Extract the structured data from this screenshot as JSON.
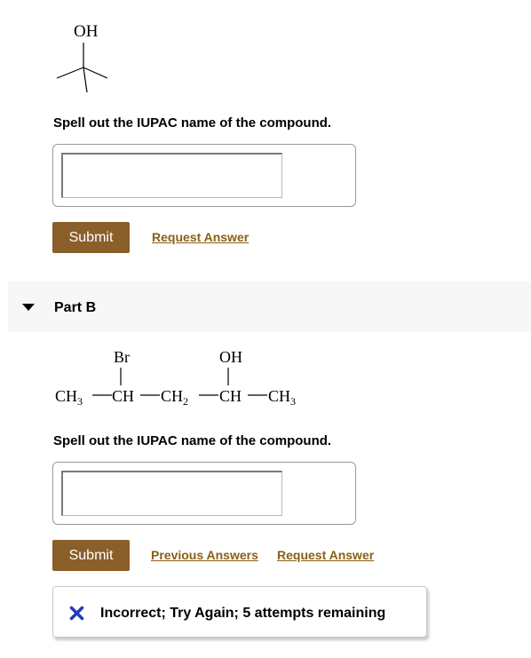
{
  "part_a": {
    "molecule_label": "OH",
    "question": "Spell out the IUPAC name of the compound.",
    "answer_value": "",
    "submit_label": "Submit",
    "request_answer_label": "Request Answer"
  },
  "part_b": {
    "title": "Part B",
    "molecule": {
      "top_labels": [
        "Br",
        "OH"
      ],
      "chain": [
        {
          "main": "CH",
          "sub": "3"
        },
        {
          "main": "CH",
          "sub": ""
        },
        {
          "main": "CH",
          "sub": "2"
        },
        {
          "main": "CH",
          "sub": ""
        },
        {
          "main": "CH",
          "sub": "3"
        }
      ]
    },
    "question": "Spell out the IUPAC name of the compound.",
    "answer_value": "",
    "submit_label": "Submit",
    "previous_answers_label": "Previous Answers",
    "request_answer_label": "Request Answer",
    "feedback": {
      "text": "Incorrect; Try Again; 5 attempts remaining",
      "color": "#1f3fb5"
    }
  }
}
